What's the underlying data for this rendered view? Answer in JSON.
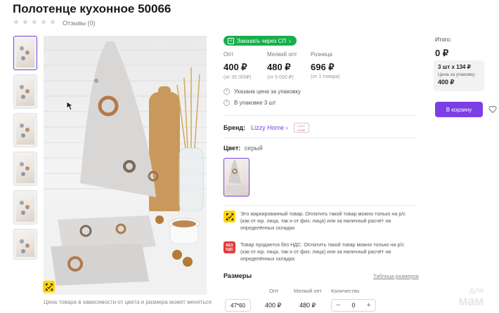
{
  "product": {
    "title": "Полотенце кухонное 50066",
    "reviews": "Отзывы (0)",
    "caption": "Цена товара в зависимости от цвета и размера может меняться"
  },
  "badge": {
    "sp": "Заказать через СП"
  },
  "prices": [
    {
      "label": "Опт",
      "value": "400 ₽",
      "note": "(от 35 000₽)"
    },
    {
      "label": "Мелкий опт",
      "value": "480 ₽",
      "note": "(от 5 000 ₽)"
    },
    {
      "label": "Розница",
      "value": "696 ₽",
      "note": "(от 1 товара)"
    }
  ],
  "info": {
    "pack_price": "Указана цена за упаковку",
    "pack_count": "В упаковке 3 шт"
  },
  "brand": {
    "label": "Бренд:",
    "value": "Lizzy Home",
    "logo": "LIZZY HOME"
  },
  "color": {
    "label": "Цвет:",
    "value": "серый"
  },
  "notices": {
    "marked": "Это маркированный товар. Оплатить такой товар можно только на р/с (как от юр. лица, так и от физ. лица) или за наличный расчёт на определённых складах",
    "no_vat": "Товар продается без НДС. Оплатить такой товар можно только на р/с (как от юр. лица, так и от физ. лица) или за наличный расчёт на определённых складах",
    "no_vat_badge_1": "БЕЗ",
    "no_vat_badge_2": "НДС"
  },
  "sizes": {
    "heading": "Размеры",
    "table_link": "Таблица размеров",
    "col_opt": "Опт",
    "col_small_opt": "Мелкий опт",
    "col_qty": "Количество",
    "row": {
      "size": "47*60",
      "opt": "400 ₽",
      "small_opt": "480 ₽",
      "qty": "0"
    }
  },
  "summary": {
    "label": "Итого:",
    "value": "0 ₽",
    "qty": "3 шт х 134 ₽",
    "per_pack_label": "Цена за упаковку:",
    "per_pack_value": "400 ₽",
    "cart": "В корзину"
  },
  "watermark": {
    "line1": "для",
    "line2": "мам"
  },
  "colors": {
    "accent": "#7b3fe4",
    "green": "#16b04a",
    "yellow": "#ffd400",
    "red": "#e43a3a"
  },
  "icons": [
    "star-icon",
    "plus-icon",
    "chevron-right-icon",
    "info-icon",
    "marking-icon",
    "heart-icon",
    "minus-icon"
  ]
}
